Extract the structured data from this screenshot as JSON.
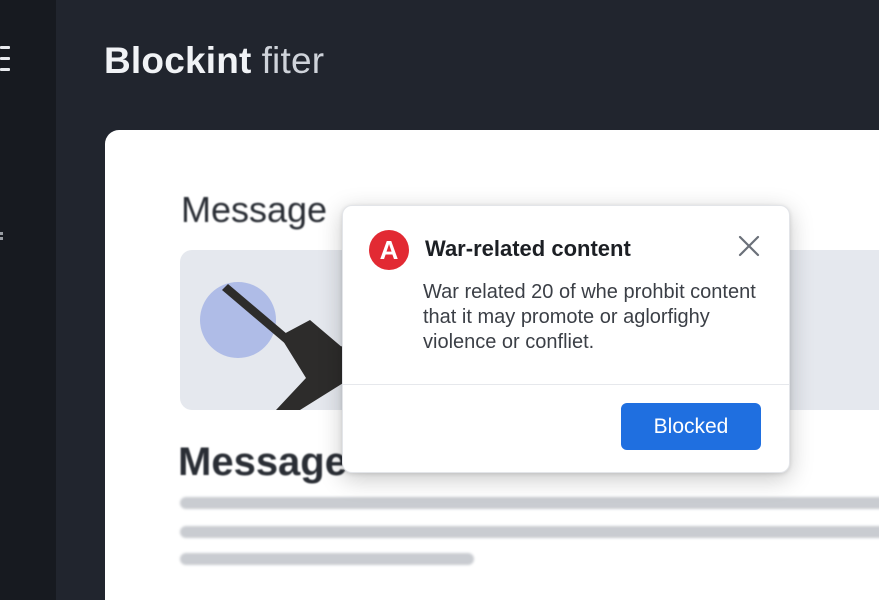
{
  "header": {
    "title_part1": "Blockint",
    "title_part2": "fiter"
  },
  "main": {
    "message_heading_1": "Message",
    "message_heading_2": "Message"
  },
  "dialog": {
    "badge_letter": "A",
    "title": "War-related content",
    "body": "War related 20 of whe prohbit content that it may promote or aglorfighy violence or confliet.",
    "button_label": "Blocked"
  },
  "icons": {
    "menu": "menu-icon",
    "close": "close-icon",
    "alert": "alert-icon"
  },
  "colors": {
    "background": "#21252e",
    "sidebar": "#171a20",
    "panel": "#ffffff",
    "alert_red": "#e22a33",
    "button_blue": "#1f6fe0"
  }
}
